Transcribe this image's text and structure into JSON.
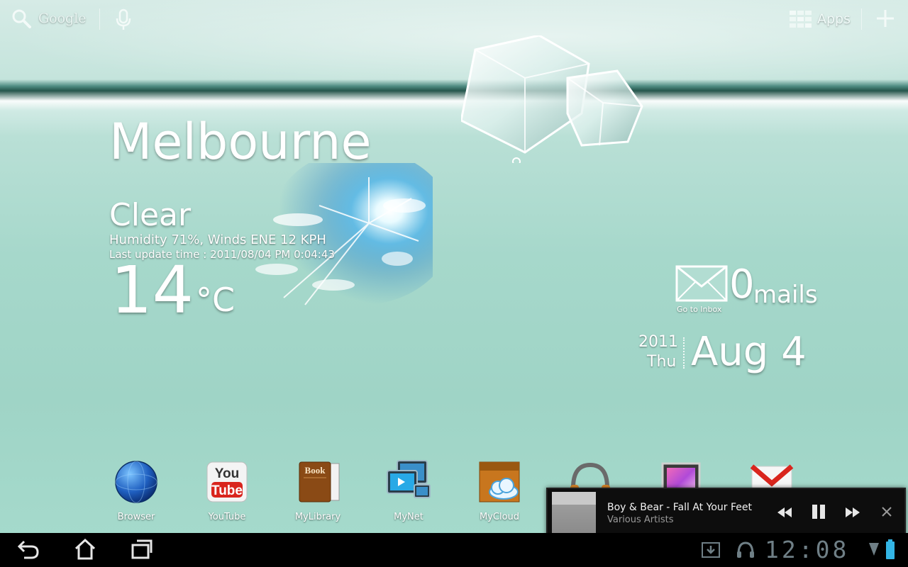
{
  "topbar": {
    "search_label": "Google",
    "apps_label": "Apps"
  },
  "weather": {
    "city": "Melbourne",
    "condition": "Clear",
    "details": "Humidity 71%, Winds ENE 12 KPH",
    "update": "Last update time : 2011/08/04 PM 0:04:43",
    "temperature": "14",
    "unit": "°C"
  },
  "mail": {
    "count": "0",
    "word": "mails",
    "inbox_label": "Go to Inbox"
  },
  "date": {
    "year": "2011",
    "weekday": "Thu",
    "main": "Aug 4"
  },
  "dock": [
    {
      "label": "Browser",
      "icon": "browser-globe-icon"
    },
    {
      "label": "YouTube",
      "icon": "youtube-icon"
    },
    {
      "label": "MyLibrary",
      "icon": "mylibrary-book-icon"
    },
    {
      "label": "MyNet",
      "icon": "mynet-icon"
    },
    {
      "label": "MyCloud",
      "icon": "mycloud-icon"
    },
    {
      "label": "",
      "icon": "music-headphones-icon"
    },
    {
      "label": "",
      "icon": "gallery-icon"
    },
    {
      "label": "",
      "icon": "gmail-icon"
    }
  ],
  "dock_text": {
    "youtube_you": "You",
    "youtube_tube": "Tube",
    "book": "Book"
  },
  "music": {
    "track": "Boy & Bear - Fall At Your Feet",
    "artist": "Various Artists"
  },
  "system": {
    "clock": "12:08"
  },
  "colors": {
    "sysbar": "#000000",
    "clock": "#6f7f86",
    "accent": "#33b5e5"
  }
}
